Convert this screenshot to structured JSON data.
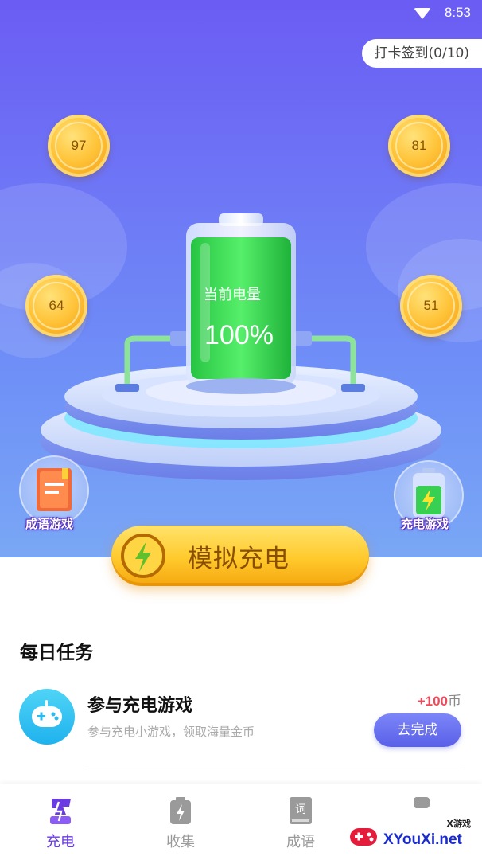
{
  "status_bar": {
    "time": "8:53"
  },
  "header": {
    "checkin_label": "打卡签到(0/10)"
  },
  "coins": {
    "top_left": "97",
    "top_right": "81",
    "mid_left": "64",
    "mid_right": "51"
  },
  "battery": {
    "label": "当前电量",
    "percent": "100%",
    "level": 1.0
  },
  "side_games": {
    "left_label": "成语游戏",
    "right_label": "充电游戏"
  },
  "main_action": {
    "label": "模拟充电"
  },
  "tasks": {
    "title": "每日任务",
    "items": [
      {
        "name": "参与充电游戏",
        "description": "参与充电小游戏，领取海量金币",
        "reward_amount": "+100",
        "reward_unit": "币",
        "button_label": "去完成"
      }
    ]
  },
  "bottom_nav": {
    "items": [
      {
        "label": "充电",
        "active": true
      },
      {
        "label": "收集",
        "active": false
      },
      {
        "label": "成语",
        "active": false
      }
    ]
  },
  "watermark": {
    "sub": "X游戏",
    "main": "XYouXi.net"
  },
  "colors": {
    "hero_top": "#6b5cf3",
    "accent_purple": "#6a3be0",
    "battery_green": "#2fd24a",
    "reward_red": "#f04a5a",
    "button_blue": "#5a5fe8"
  }
}
